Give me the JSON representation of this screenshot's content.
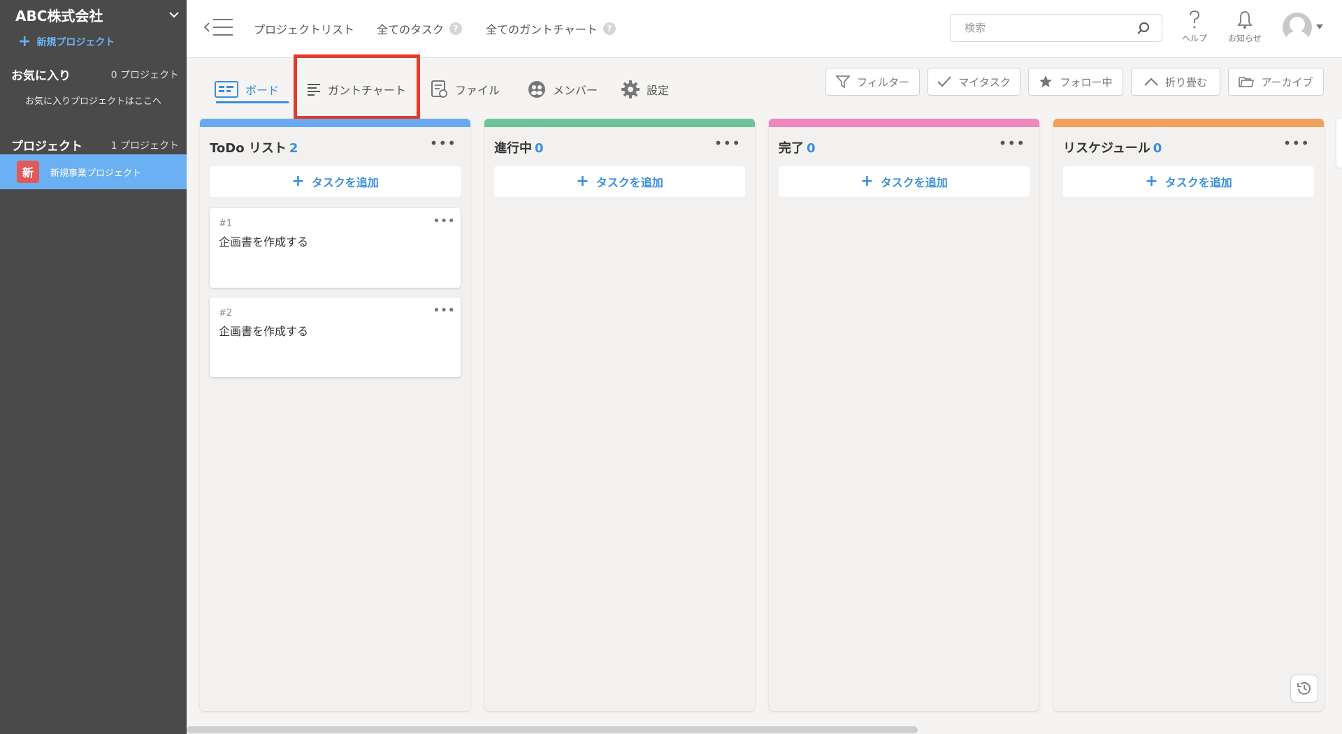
{
  "sidebar": {
    "org_name": "ABC株式会社",
    "new_project": "新規プロジェクト",
    "favorites": {
      "title": "お気に入り",
      "count": "0 プロジェクト",
      "empty_text": "お気に入りプロジェクトはここへ"
    },
    "projects": {
      "title": "プロジェクト",
      "count": "1 プロジェクト",
      "items": [
        {
          "badge": "新",
          "name": "新規事業プロジェクト"
        }
      ]
    }
  },
  "topbar": {
    "links": [
      "プロジェクトリスト",
      "全てのタスク",
      "全てのガントチャート"
    ],
    "help_badge": "?",
    "search_placeholder": "検索",
    "help_label": "ヘルプ",
    "notify_label": "お知らせ"
  },
  "tabs": [
    {
      "label": "ボード",
      "icon": "board-icon"
    },
    {
      "label": "ガントチャート",
      "icon": "gantt-icon"
    },
    {
      "label": "ファイル",
      "icon": "file-icon"
    },
    {
      "label": "メンバー",
      "icon": "member-icon"
    },
    {
      "label": "設定",
      "icon": "gear-icon"
    }
  ],
  "filters": [
    {
      "label": "フィルター",
      "icon": "filter-icon"
    },
    {
      "label": "マイタスク",
      "icon": "check-icon"
    },
    {
      "label": "フォロー中",
      "icon": "star-icon"
    },
    {
      "label": "折り畳む",
      "icon": "chevron-up-icon"
    },
    {
      "label": "アーカイブ",
      "icon": "folder-icon"
    }
  ],
  "columns": [
    {
      "title": "ToDo リスト",
      "count": "2",
      "color": "#6aaaf0",
      "cards": [
        {
          "num": "#1",
          "title": "企画書を作成する"
        },
        {
          "num": "#2",
          "title": "企画書を作成する"
        }
      ]
    },
    {
      "title": "進行中",
      "count": "0",
      "color": "#6cc39a",
      "cards": []
    },
    {
      "title": "完了",
      "count": "0",
      "color": "#ef86bd",
      "cards": []
    },
    {
      "title": "リスケジュール",
      "count": "0",
      "color": "#f3a05c",
      "cards": []
    }
  ],
  "add_task_label": "タスクを追加",
  "colors": {
    "accent": "#3a8de0",
    "sidebar_bg": "#4a4a4a",
    "highlight": "#e03c2c"
  }
}
